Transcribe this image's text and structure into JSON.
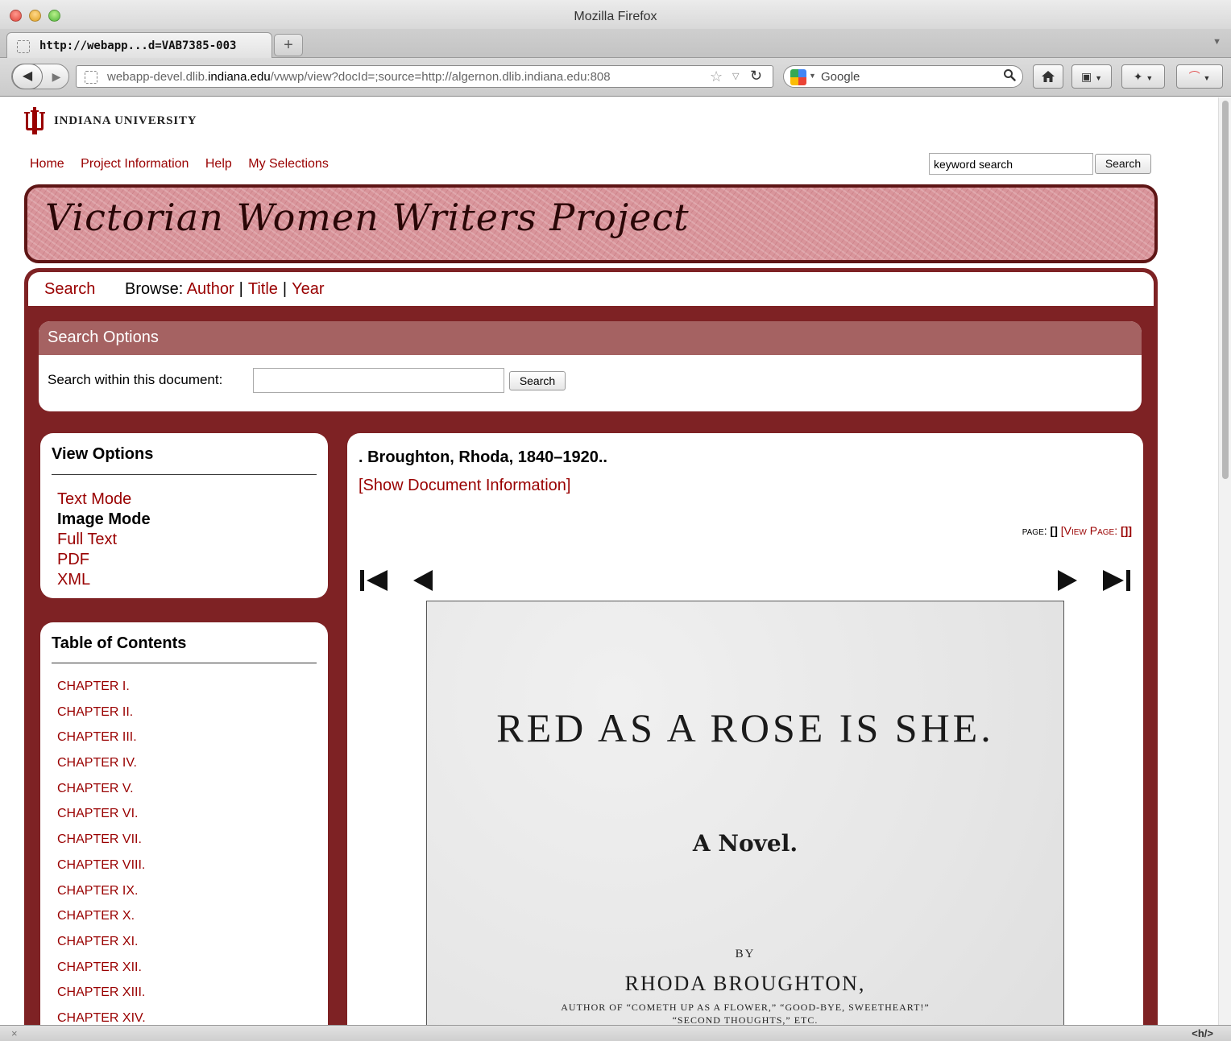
{
  "browser": {
    "window_title": "Mozilla Firefox",
    "tab_title": "http://webapp...d=VAB7385-003",
    "new_tab_label": "+",
    "url_prefix": "webapp-devel.dlib.",
    "url_host": "indiana.edu",
    "url_suffix": "/vwwp/view?docId=;source=http://algernon.dlib.indiana.edu:808",
    "search_engine": "Google",
    "status_tag": "<h/>"
  },
  "site": {
    "university": "INDIANA UNIVERSITY",
    "nav": [
      "Home",
      "Project Information",
      "Help",
      "My Selections"
    ],
    "keyword_placeholder": "keyword search",
    "search_button": "Search",
    "banner_title": "Victorian Women Writers Project",
    "browse_bar": {
      "search": "Search",
      "browse_label": "Browse:",
      "author": "Author",
      "title": "Title",
      "year": "Year"
    },
    "search_options": {
      "header": "Search Options",
      "label": "Search within this document:",
      "button": "Search"
    },
    "view_options": {
      "title": "View Options",
      "items": [
        "Text Mode",
        "Image Mode",
        "Full Text",
        "PDF",
        "XML"
      ],
      "current": "Image Mode"
    },
    "toc": {
      "title": "Table of Contents",
      "items": [
        "CHAPTER I.",
        "CHAPTER II.",
        "CHAPTER III.",
        "CHAPTER IV.",
        "CHAPTER V.",
        "CHAPTER VI.",
        "CHAPTER VII.",
        "CHAPTER VIII.",
        "CHAPTER IX.",
        "CHAPTER X.",
        "CHAPTER XI.",
        "CHAPTER XII.",
        "CHAPTER XIII.",
        "CHAPTER XIV."
      ]
    },
    "document": {
      "author_line": ". Broughton, Rhoda, 1840–1920..",
      "show_info": "[Show Document Information]",
      "page_label": "page:",
      "page_value": "[]",
      "view_page_label": "[View Page:",
      "view_page_value": "[]]"
    },
    "scan": {
      "title": "RED AS A ROSE IS SHE.",
      "subtitle": "A Novel.",
      "by": "BY",
      "author": "RHODA BROUGHTON,",
      "works_line1": "AUTHOR OF “COMETH UP AS A FLOWER,” “GOOD-BYE, SWEETHEART!”",
      "works_line2": "“SECOND THOUGHTS,” ETC."
    }
  },
  "colors": {
    "link": "#990000",
    "frame": "#7e2224",
    "search_options_header": "#a56262",
    "banner": "#d9959b"
  }
}
